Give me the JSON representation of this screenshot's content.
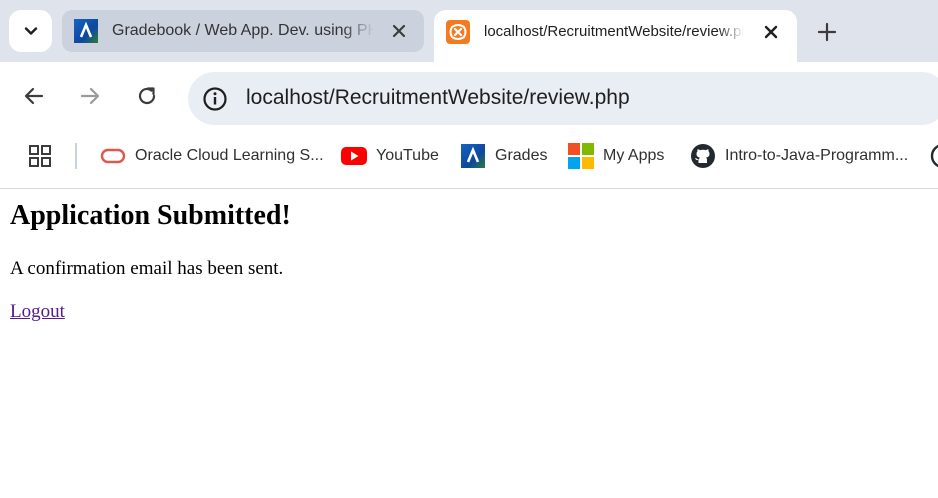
{
  "browser": {
    "tabs": [
      {
        "title": "Gradebook / Web App. Dev. using PHP",
        "icon": "gradebook-favicon",
        "active": false
      },
      {
        "title": "localhost/RecruitmentWebsite/review.php",
        "icon": "xampp-favicon",
        "active": true
      }
    ],
    "url": "localhost/RecruitmentWebsite/review.php",
    "bookmarks": [
      {
        "label": "Oracle Cloud Learning S...",
        "icon": "oracle-icon"
      },
      {
        "label": "YouTube",
        "icon": "youtube-icon"
      },
      {
        "label": "Grades",
        "icon": "grades-icon"
      },
      {
        "label": "My Apps",
        "icon": "microsoft-icon"
      },
      {
        "label": "Intro-to-Java-Programm...",
        "icon": "github-icon"
      }
    ]
  },
  "page": {
    "heading": "Application Submitted!",
    "message": "A confirmation email has been sent.",
    "logout_label": "Logout"
  },
  "colors": {
    "tabstrip_bg": "#dfe3eb",
    "omnibox_bg": "#e9edf4",
    "visited_link": "#551a8b",
    "xampp_orange": "#f37a20",
    "youtube_red": "#ff0000"
  }
}
